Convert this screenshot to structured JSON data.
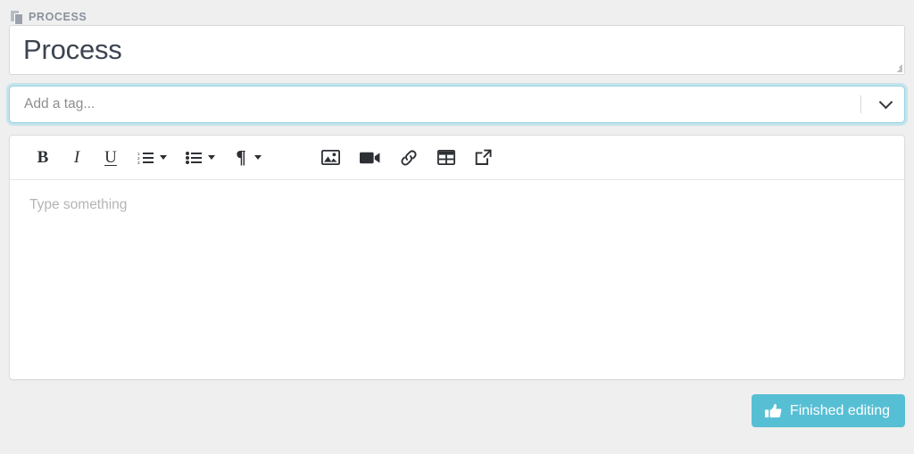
{
  "colors": {
    "page_background": "#efefef",
    "accent_button": "#57bfd4",
    "focus_ring": "#92d4e6",
    "label_text": "#8a929c",
    "title_text": "#3d4450",
    "placeholder_text": "#b4b4b4"
  },
  "section": {
    "icon": "copy-icon",
    "label": "PROCESS"
  },
  "title_field": {
    "value": "Process",
    "resize_grip": "resize-grip"
  },
  "tag_field": {
    "placeholder": "Add a tag...",
    "value": "",
    "dropdown_icon": "chevron-down-icon"
  },
  "editor": {
    "toolbar": {
      "groups": [
        {
          "name": "formatting",
          "items": [
            {
              "name": "bold-button",
              "glyph": "B",
              "icon": "bold-icon",
              "has_caret": false
            },
            {
              "name": "italic-button",
              "glyph": "I",
              "icon": "italic-icon",
              "has_caret": false
            },
            {
              "name": "underline-button",
              "glyph": "U",
              "icon": "underline-icon",
              "has_caret": false
            },
            {
              "name": "ordered-list-button",
              "glyph": "",
              "icon": "ordered-list-icon",
              "has_caret": true
            },
            {
              "name": "unordered-list-button",
              "glyph": "",
              "icon": "unordered-list-icon",
              "has_caret": true
            },
            {
              "name": "paragraph-style-button",
              "glyph": "¶",
              "icon": "pilcrow-icon",
              "has_caret": true
            }
          ]
        },
        {
          "name": "insert",
          "items": [
            {
              "name": "insert-image-button",
              "glyph": "",
              "icon": "image-icon",
              "has_caret": false
            },
            {
              "name": "insert-video-button",
              "glyph": "",
              "icon": "video-camera-icon",
              "has_caret": false
            },
            {
              "name": "insert-link-button",
              "glyph": "",
              "icon": "link-icon",
              "has_caret": false
            },
            {
              "name": "insert-table-button",
              "glyph": "",
              "icon": "table-icon",
              "has_caret": false
            },
            {
              "name": "open-external-button",
              "glyph": "",
              "icon": "external-link-icon",
              "has_caret": false
            }
          ]
        }
      ]
    },
    "body": {
      "placeholder": "Type something",
      "value": ""
    }
  },
  "footer": {
    "primary_button": {
      "label": "Finished editing",
      "icon": "thumbs-up-icon"
    }
  }
}
